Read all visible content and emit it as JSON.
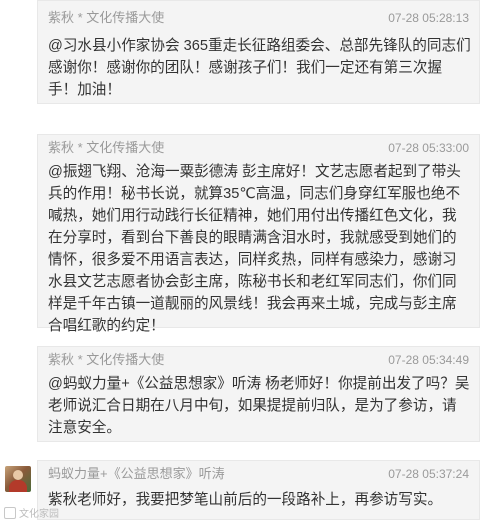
{
  "comments": [
    {
      "author": "紫秋 * 文化传播大使",
      "time": "07-28 05:28:13",
      "text": "@习水县小作家协会 365重走长征路组委会、总部先锋队的同志们感谢你！感谢你的团队！感谢孩子们！我们一定还有第三次握手！加油！"
    },
    {
      "author": "紫秋 * 文化传播大使",
      "time": "07-28 05:33:00",
      "text": "@振翅飞翔、沧海一粟彭德涛 彭主席好！文艺志愿者起到了带头兵的作用！秘书长说，就算35℃高温，同志们身穿红军服也绝不喊热，她们用行动践行长征精神，她们用付出传播红色文化，我在分享时，看到台下善良的眼睛满含泪水时，我就感受到她们的情怀，很多爱不用语言表达，同样炙热，同样有感染力，感谢习水县文艺志愿者协会彭主席，陈秘书长和老红军同志们，你们同样是千年古镇一道靓丽的风景线！我会再来土城，完成与彭主席合唱红歌的约定！"
    },
    {
      "author": "紫秋 * 文化传播大使",
      "time": "07-28 05:34:49",
      "text": "@蚂蚁力量+《公益思想家》听涛 杨老师好！你提前出发了吗？吴老师说汇合日期在八月中旬，如果提提前归队，是为了参访，请注意安全。"
    },
    {
      "author": "蚂蚁力量+《公益思想家》听涛",
      "time": "07-28 05:37:24",
      "text": "紫秋老师好，我要把梦笔山前后的一段路补上，再参访写实。"
    }
  ],
  "avatar": {
    "name": "avatar-photo"
  },
  "watermark": {
    "text": "文化家园"
  }
}
